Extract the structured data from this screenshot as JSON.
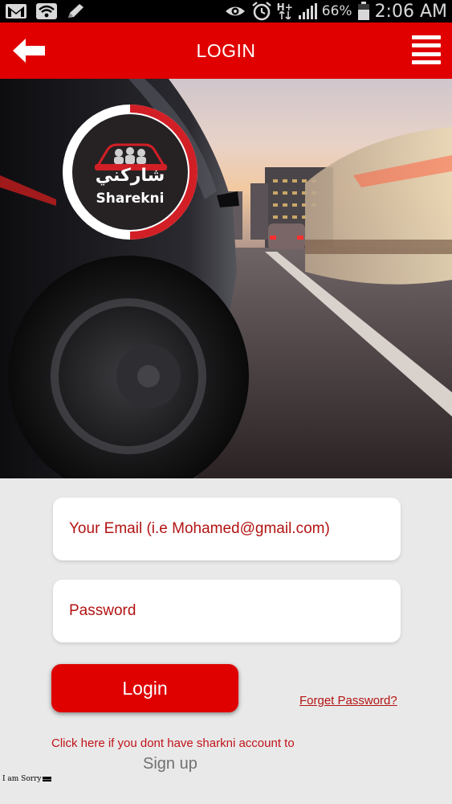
{
  "status_bar": {
    "icons": [
      "gmail-icon",
      "wifi-icon",
      "pencil-icon",
      "eye-icon",
      "alarm-icon",
      "hplus-data-icon",
      "signal-icon",
      "battery-icon"
    ],
    "data_label": "H+",
    "battery": "66%",
    "time": "2:06 AM"
  },
  "header": {
    "title": "LOGIN",
    "background": "#e00000"
  },
  "logo": {
    "arabic_text": "شاركني",
    "name": "Sharekni"
  },
  "form": {
    "email_placeholder": "Your Email (i.e Mohamed@gmail.com)",
    "password_placeholder": "Password",
    "login_label": "Login",
    "forget_label": "Forget Password?",
    "signup_hint": "Click here if you dont have sharkni account to",
    "signup_label": "Sign up",
    "accent": "#df0000"
  },
  "footer": {
    "note": "I am Sorry"
  }
}
